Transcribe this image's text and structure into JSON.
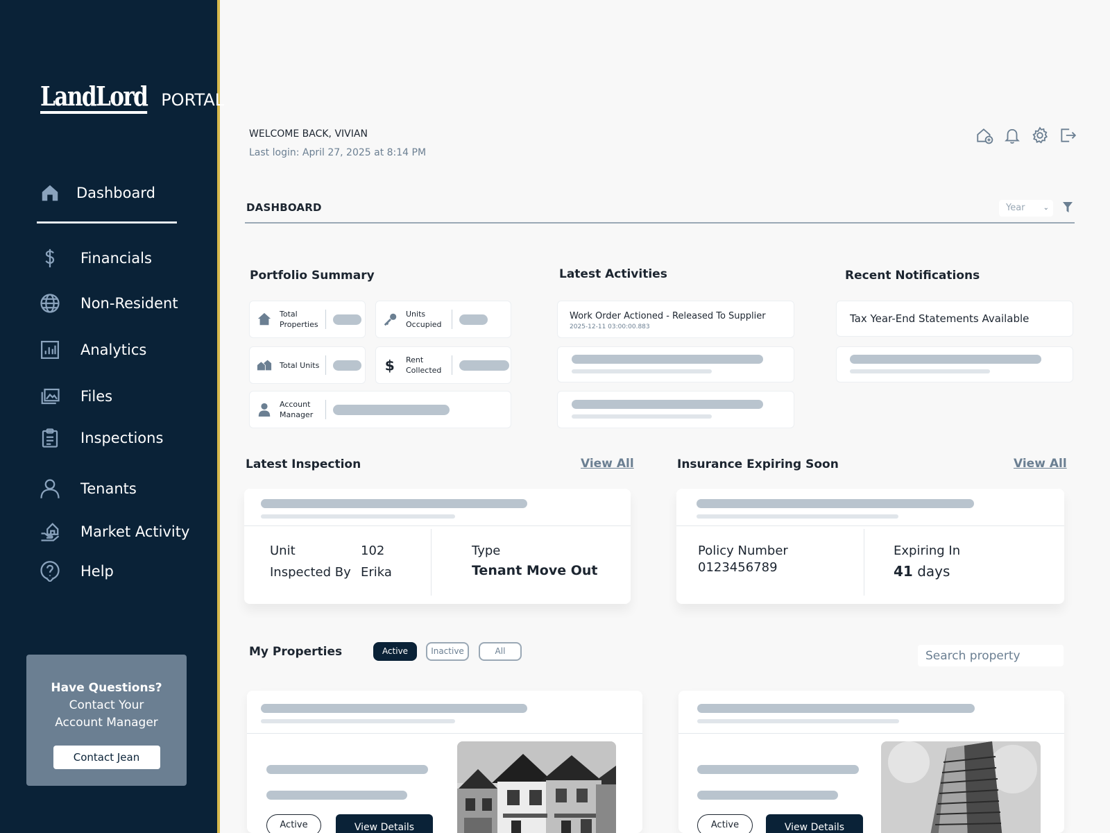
{
  "sidebar": {
    "logo": {
      "brand": "LandLord",
      "portal": "PORTAL"
    },
    "items": [
      {
        "label": "Dashboard",
        "icon": "home-icon"
      },
      {
        "label": "Financials",
        "icon": "dollar-icon"
      },
      {
        "label": "Non-Resident",
        "icon": "globe-icon"
      },
      {
        "label": "Analytics",
        "icon": "chart-icon"
      },
      {
        "label": "Files",
        "icon": "files-icon"
      },
      {
        "label": "Inspections",
        "icon": "clipboard-icon"
      },
      {
        "label": "Tenants",
        "icon": "user-icon"
      },
      {
        "label": "Market Activity",
        "icon": "house-hand-icon"
      },
      {
        "label": "Help",
        "icon": "help-icon"
      }
    ],
    "help_card": {
      "question": "Have Questions?",
      "line1": "Contact Your",
      "line2": "Account Manager",
      "button": "Contact Jean"
    }
  },
  "header": {
    "welcome": "WELCOME BACK, VIVIAN",
    "last_login": "Last login: April 27, 2025 at 8:14 PM"
  },
  "dashboard": {
    "title": "DASHBOARD",
    "period": "Year"
  },
  "portfolio": {
    "title": "Portfolio Summary",
    "stats": [
      {
        "label": "Total Properties",
        "icon": "home-icon"
      },
      {
        "label": "Units Occupied",
        "icon": "key-icon"
      },
      {
        "label": "Total Units",
        "icon": "houses-icon"
      },
      {
        "label": "Rent Collected",
        "icon": "dollar-icon"
      },
      {
        "label": "Account Manager",
        "icon": "person-icon"
      }
    ]
  },
  "activities": {
    "title": "Latest Activities",
    "items": [
      {
        "title": "Work Order Actioned - Released To Supplier",
        "time": "2025-12-11 03:00:00.883"
      }
    ]
  },
  "notifications": {
    "title": "Recent Notifications",
    "items": [
      "Tax Year-End Statements Available"
    ]
  },
  "inspection": {
    "title": "Latest Inspection",
    "view_all": "View All",
    "unit_label": "Unit",
    "unit_value": "102",
    "inspected_by_label": "Inspected By",
    "inspected_by_value": "Erika",
    "type_label": "Type",
    "type_value": "Tenant Move Out"
  },
  "insurance": {
    "title": "Insurance Expiring Soon",
    "view_all": "View All",
    "policy_label": "Policy Number",
    "policy_value": "0123456789",
    "expiring_label": "Expiring In",
    "expiring_days": "41",
    "expiring_unit": "days"
  },
  "properties": {
    "title": "My Properties",
    "tabs": [
      "Active",
      "Inactive",
      "All"
    ],
    "search_placeholder": "Search property",
    "cards": [
      {
        "status": "Active",
        "button": "View Details"
      },
      {
        "status": "Active",
        "button": "View Details"
      }
    ]
  },
  "colors": {
    "sidebar_bg": "#0a2237",
    "accent_border": "#d7b94c",
    "muted": "#6b7f92"
  }
}
